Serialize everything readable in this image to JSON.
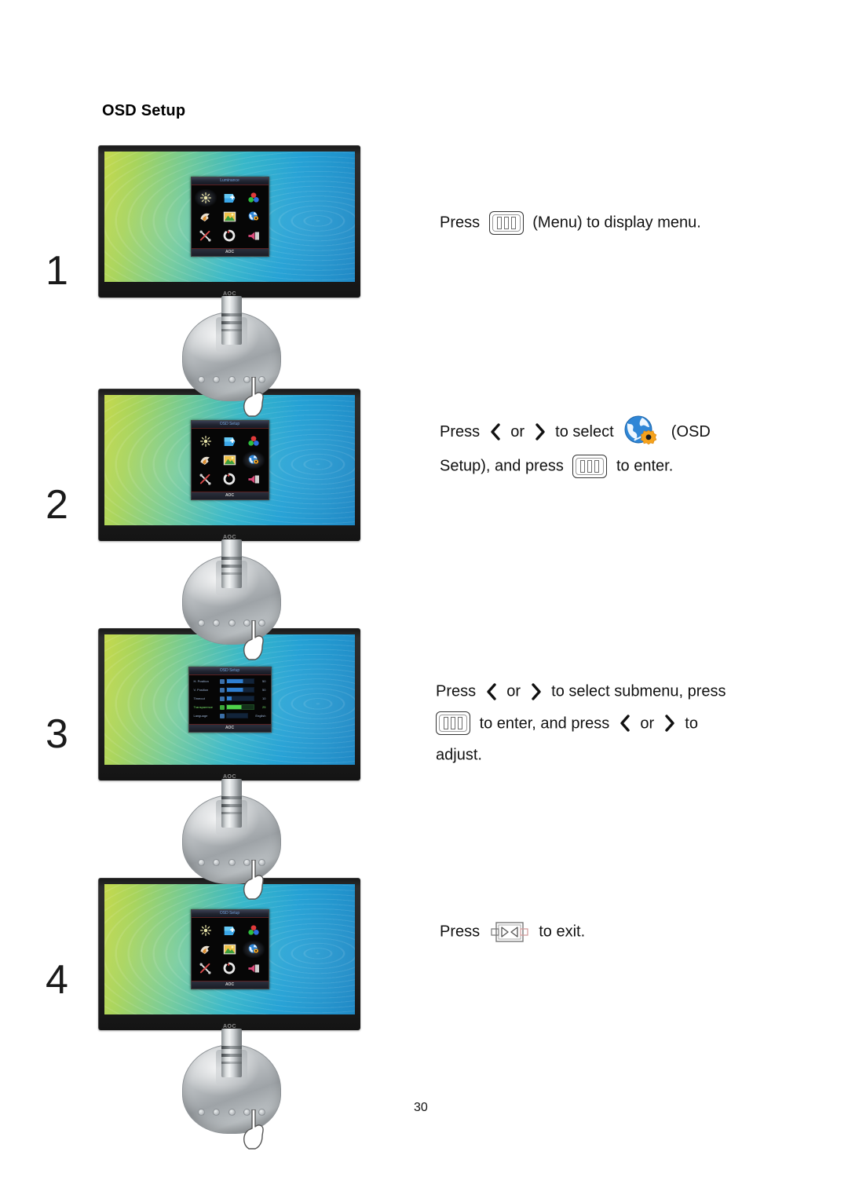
{
  "document": {
    "section_title": "OSD Setup",
    "page_number": "30"
  },
  "icons": {
    "menu_key": "menu-key-icon",
    "left_chevron": "chevron-left-icon",
    "right_chevron": "chevron-right-icon",
    "exit_key": "exit-key-icon",
    "osd_setup": "globe-gear-icon",
    "hand_pointer": "hand-pointer-icon"
  },
  "colors": {
    "screen_gradient_start": "#c5d94e",
    "screen_gradient_mid": "#34b6c8",
    "screen_gradient_end": "#1b86c4",
    "bezel": "#1a1a1a",
    "base_silver": "#c2c6c9",
    "osd_background": "#060606",
    "osd_highlight_green": "#4fd24a",
    "osd_bar_blue": "#2f7fd0",
    "globe_blue": "#2f86d6",
    "gear_orange": "#f5a21c"
  },
  "steps": [
    {
      "number": "1",
      "osd_title": "Luminance",
      "osd_brand": "AOC",
      "selected_index": 0,
      "instruction_parts": [
        {
          "type": "text",
          "value": "Press"
        },
        {
          "type": "icon",
          "value": "menu-key-icon"
        },
        {
          "type": "text",
          "value": "(Menu) to display menu."
        }
      ]
    },
    {
      "number": "2",
      "osd_title": "OSD Setup",
      "osd_brand": "AOC",
      "selected_index": 5,
      "instruction_parts": [
        {
          "type": "text",
          "value": "Press"
        },
        {
          "type": "icon",
          "value": "chevron-left-icon"
        },
        {
          "type": "text",
          "value": "or"
        },
        {
          "type": "icon",
          "value": "chevron-right-icon"
        },
        {
          "type": "text",
          "value": "to select"
        },
        {
          "type": "icon",
          "value": "globe-gear-icon"
        },
        {
          "type": "text",
          "value": "(OSD Setup), and press"
        },
        {
          "type": "icon",
          "value": "menu-key-icon"
        },
        {
          "type": "text",
          "value": "to enter."
        }
      ]
    },
    {
      "number": "3",
      "osd_title": "OSD Setup",
      "osd_brand": "AOC",
      "selected_index": 5,
      "instruction_parts": [
        {
          "type": "text",
          "value": "Press"
        },
        {
          "type": "icon",
          "value": "chevron-left-icon"
        },
        {
          "type": "text",
          "value": "or"
        },
        {
          "type": "icon",
          "value": "chevron-right-icon"
        },
        {
          "type": "text",
          "value": "to select submenu, press"
        },
        {
          "type": "icon",
          "value": "menu-key-icon"
        },
        {
          "type": "text",
          "value": "to enter, and press"
        },
        {
          "type": "icon",
          "value": "chevron-left-icon"
        },
        {
          "type": "text",
          "value": "or"
        },
        {
          "type": "icon",
          "value": "chevron-right-icon"
        },
        {
          "type": "text",
          "value": "to adjust."
        }
      ],
      "submenu_rows": [
        {
          "label": "H. Position",
          "value": "50",
          "fill": 50,
          "highlight": false
        },
        {
          "label": "V. Position",
          "value": "50",
          "fill": 50,
          "highlight": false
        },
        {
          "label": "Timeout",
          "value": "10",
          "fill": 18,
          "highlight": false
        },
        {
          "label": "Transparence",
          "value": "25",
          "fill": 45,
          "highlight": true
        },
        {
          "label": "Language",
          "value": "English",
          "fill": 0,
          "highlight": false
        }
      ]
    },
    {
      "number": "4",
      "osd_title": "OSD Setup",
      "osd_brand": "AOC",
      "selected_index": 5,
      "instruction_parts": [
        {
          "type": "text",
          "value": "Press"
        },
        {
          "type": "icon",
          "value": "exit-key-icon"
        },
        {
          "type": "text",
          "value": "to exit."
        }
      ]
    }
  ],
  "text": {
    "press": "Press",
    "or": "or",
    "menu_suffix": "(Menu) to display menu.",
    "s2_select": "to select",
    "s2_osd_open": "(OSD",
    "s2_setup_press": "Setup), and press",
    "s2_enter": "to enter.",
    "s3_select_submenu": "to select submenu, press",
    "s3_enter_and_press": "to enter, and press",
    "s3_to": "to",
    "s3_adjust": "adjust.",
    "s4_exit": "to exit."
  },
  "osd_menu_icons": [
    "brightness-sun-icon",
    "image-setup-icon",
    "color-setup-icon",
    "picture-boost-icon",
    "picture-frame-icon",
    "osd-setup-globe-gear-icon",
    "extra-tools-icon",
    "reset-circle-icon",
    "exit-speaker-icon"
  ]
}
